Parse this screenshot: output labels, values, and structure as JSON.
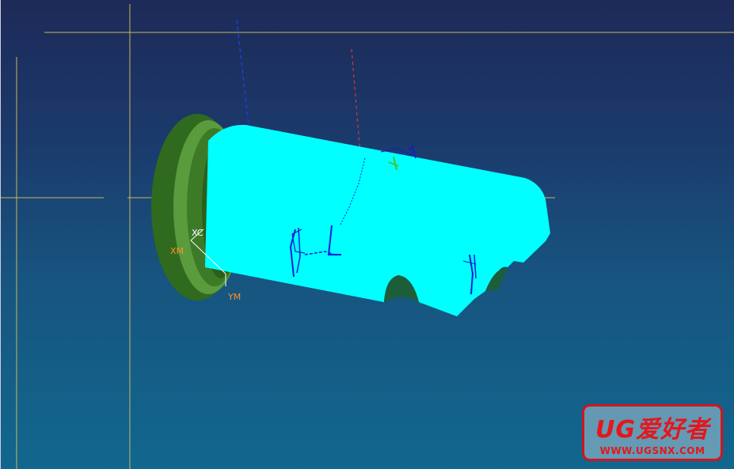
{
  "viewport": {
    "axis_labels": {
      "xc": "XC",
      "xm": "XM",
      "ym": "YM"
    },
    "colors": {
      "background_top": "#1d2a58",
      "background_bottom": "#11678f",
      "workpiece": "#00ffff",
      "fixture": "#3f7a2a",
      "crosshair": "#c8b85a",
      "toolpath": "#0a1fd6"
    }
  },
  "watermark": {
    "line1": "UG爱好者",
    "line2": "WWW.UGSNX.COM"
  }
}
